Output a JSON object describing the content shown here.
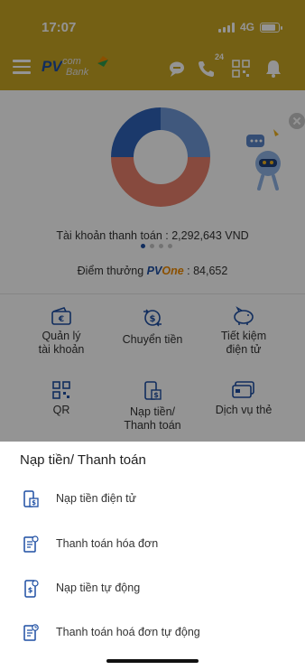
{
  "status_bar": {
    "time": "17:07",
    "network": "4G",
    "battery_level": 0.85
  },
  "app_bar": {
    "logo": {
      "pv": "PV",
      "com": "com",
      "bank": "Bank"
    },
    "icons": [
      "menu-icon",
      "chat-icon",
      "phone-24-icon",
      "qr-icon",
      "bell-icon"
    ],
    "phone_badge": "24"
  },
  "dashboard": {
    "account_text": "Tài khoản thanh toán : 2,292,643 VND",
    "points_label": "Điểm thưởng",
    "points_brand_pv": "PV",
    "points_brand_one": "One",
    "points_value": ": 84,652",
    "carousel_pages": 4,
    "carousel_active": 1,
    "chart_colors": {
      "blue_dark": "#2f63b8",
      "blue_light": "#6f98d8",
      "red": "#e8806b"
    }
  },
  "tiles": [
    {
      "label": "Quản lý\ntài khoản",
      "icon": "wallet-icon"
    },
    {
      "label": "Chuyển tiền",
      "icon": "transfer-icon"
    },
    {
      "label": "Tiết kiệm\nđiện tử",
      "icon": "piggy-bank-icon"
    },
    {
      "label": "QR",
      "icon": "qr-code-icon"
    },
    {
      "label": "Nạp tiền/\nThanh toán",
      "icon": "topup-icon"
    },
    {
      "label": "Dịch vụ thẻ",
      "icon": "card-icon"
    }
  ],
  "sheet": {
    "title": "Nạp tiền/ Thanh toán",
    "items": [
      {
        "label": "Nạp tiền điện tử",
        "icon": "mobile-topup-icon"
      },
      {
        "label": "Thanh toán hóa đơn",
        "icon": "bill-icon"
      },
      {
        "label": "Nạp tiền tự động",
        "icon": "auto-topup-icon"
      },
      {
        "label": "Thanh toán hoá đơn tự động",
        "icon": "auto-bill-icon"
      }
    ]
  },
  "colors": {
    "brand_gold": "#c9a524",
    "brand_blue": "#1e4fa3",
    "brand_orange": "#f08a00"
  }
}
